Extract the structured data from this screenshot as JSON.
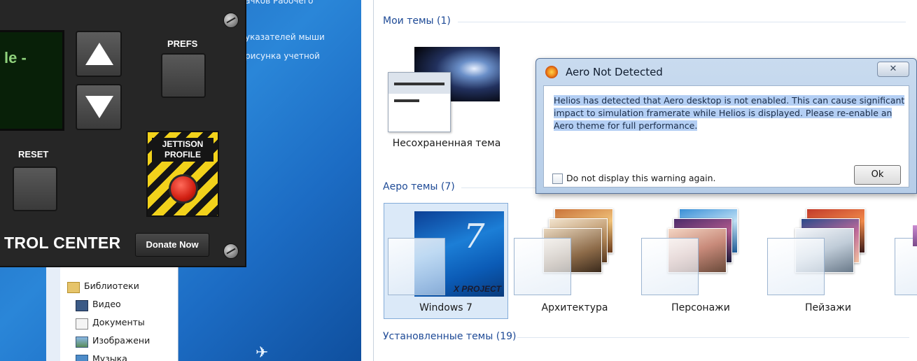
{
  "desktop": {
    "links": [
      "Изменение значков Рабочего",
      "указателей мыши",
      "рисунка учетной"
    ],
    "explorer_items": [
      {
        "label": "Библиотеки",
        "icon": "folder-icon"
      },
      {
        "label": "Видео",
        "icon": "video-icon"
      },
      {
        "label": "Документы",
        "icon": "document-icon"
      },
      {
        "label": "Изображени",
        "icon": "image-icon"
      },
      {
        "label": "Музыка",
        "icon": "music-icon"
      }
    ]
  },
  "control_panel": {
    "display_text": "le -",
    "prefs_label": "PREFS",
    "reset_label": "RESET",
    "jettison_label": "JETTISON PROFILE",
    "title": "TROL CENTER",
    "donate_label": "Donate Now"
  },
  "personalization": {
    "my_themes_header": "Мои темы (1)",
    "unsaved_theme_caption": "Несохраненная тема",
    "aero_themes_header": "Аеро темы (7)",
    "aero_themes": [
      {
        "caption": "Windows 7",
        "selected": true
      },
      {
        "caption": "Архитектура",
        "selected": false
      },
      {
        "caption": "Персонажи",
        "selected": false
      },
      {
        "caption": "Пейзажи",
        "selected": false
      }
    ],
    "win7_wallpaper_text": "X PROJECT",
    "installed_themes_header": "Установленные темы (19)"
  },
  "dialog": {
    "title": "Aero Not Detected",
    "close_symbol": "✕",
    "message": "Helios has detected that Aero desktop is not enabled. This can cause significant impact to simulation framerate while Helios is displayed. Please re-enable an Aero theme for full performance.",
    "checkbox_label": "Do not display this warning again.",
    "checkbox_checked": false,
    "ok_label": "Ok"
  }
}
